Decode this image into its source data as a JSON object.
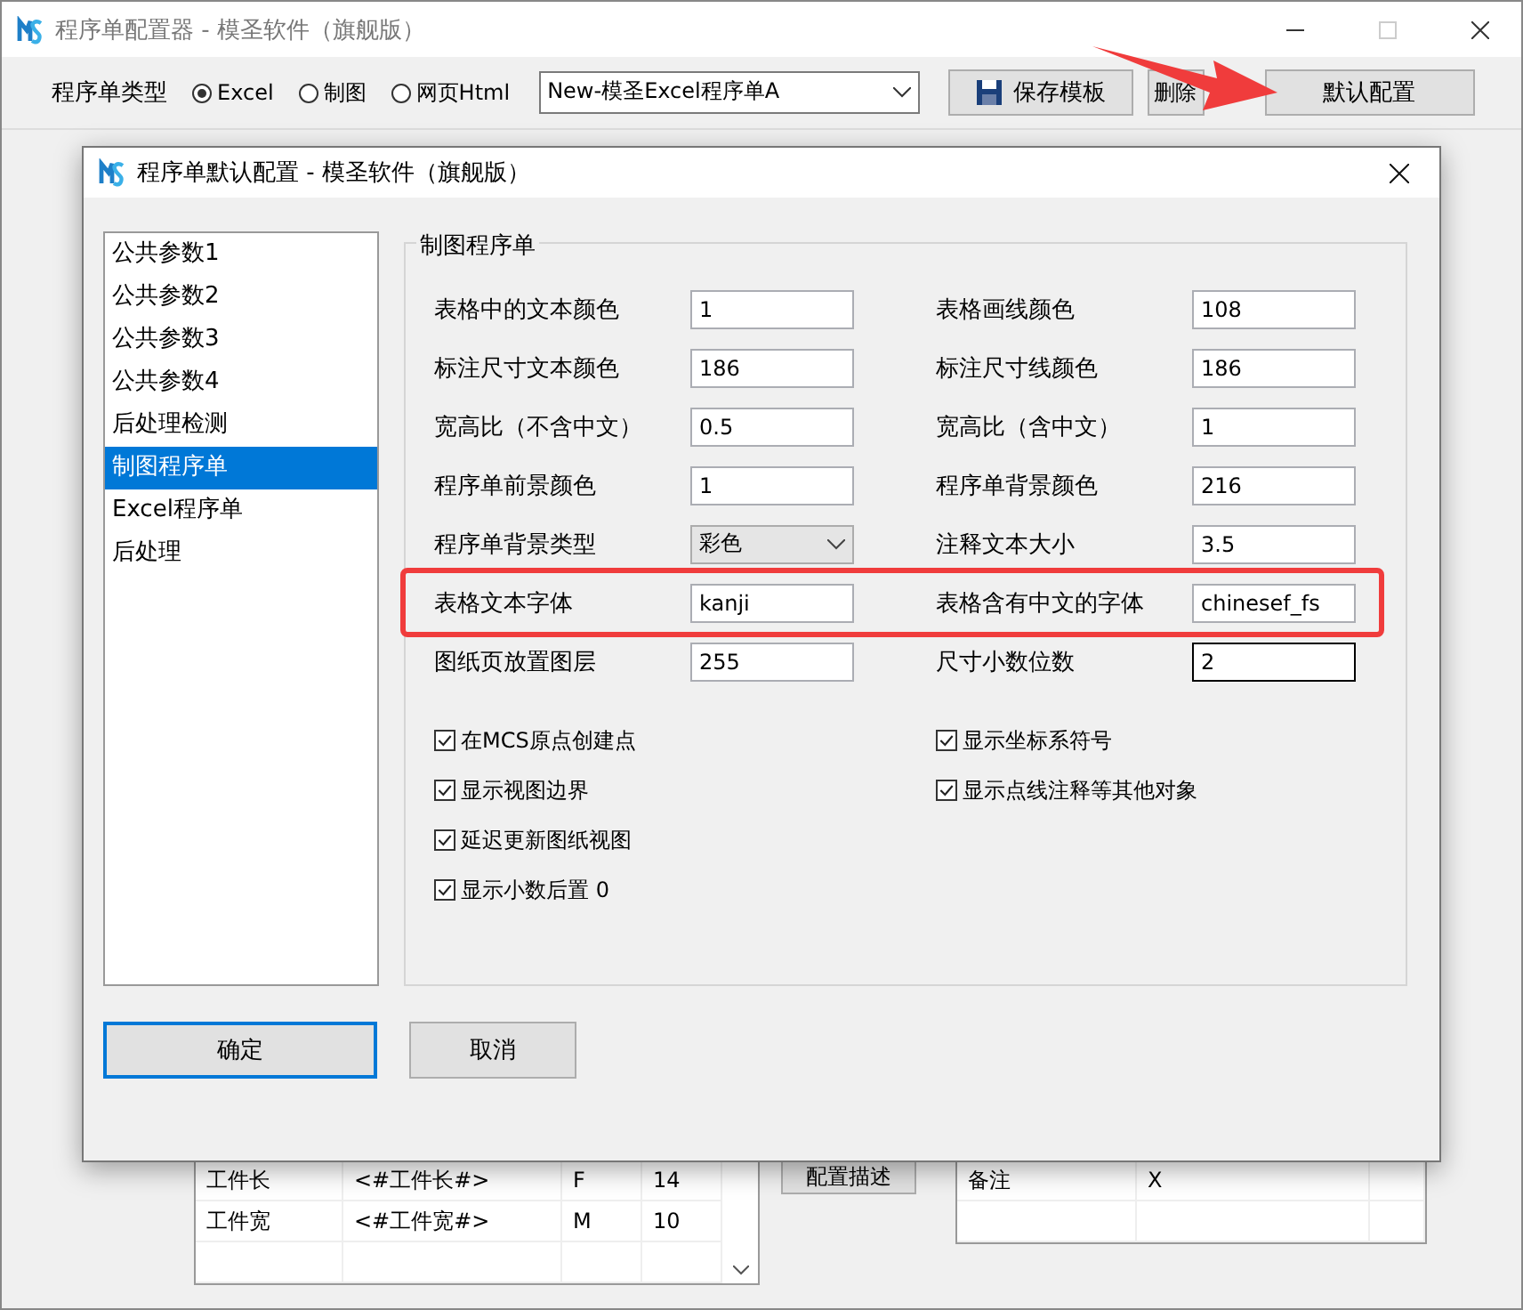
{
  "window": {
    "title": "程序单配置器 - 模圣软件（旗舰版）"
  },
  "toolbar": {
    "type_label": "程序单类型",
    "radios": [
      {
        "label": "Excel",
        "selected": true
      },
      {
        "label": "制图",
        "selected": false
      },
      {
        "label": "网页Html",
        "selected": false
      }
    ],
    "template_combo": {
      "value": "New-模圣Excel程序单A"
    },
    "buttons": [
      {
        "label": "保存模板",
        "kind": "save"
      },
      {
        "label": "删除",
        "kind": "small"
      },
      {
        "label": "默认配置",
        "kind": "wide"
      }
    ]
  },
  "bottom": {
    "left_table": {
      "rows": [
        [
          "工件长",
          "<#工件长#>",
          "F",
          "14"
        ],
        [
          "工件宽",
          "<#工件宽#>",
          "M",
          "10"
        ]
      ]
    },
    "describe_button": "配置描述",
    "right_table": {
      "rows": [
        [
          "备注",
          "X"
        ],
        [
          "",
          ""
        ]
      ]
    }
  },
  "dialog": {
    "title": "程序单默认配置 - 模圣软件（旗舰版）",
    "categories": [
      {
        "label": "公共参数1",
        "selected": false
      },
      {
        "label": "公共参数2",
        "selected": false
      },
      {
        "label": "公共参数3",
        "selected": false
      },
      {
        "label": "公共参数4",
        "selected": false
      },
      {
        "label": "后处理检测",
        "selected": false
      },
      {
        "label": "制图程序单",
        "selected": true
      },
      {
        "label": "Excel程序单",
        "selected": false
      },
      {
        "label": "后处理",
        "selected": false
      }
    ],
    "group": {
      "title": "制图程序单",
      "rows": [
        {
          "highlighted": false,
          "fields": [
            {
              "label": "表格中的文本颜色",
              "value": "1",
              "kind": "text",
              "focused": false
            },
            {
              "label": "表格画线颜色",
              "value": "108",
              "kind": "text",
              "focused": false
            }
          ]
        },
        {
          "highlighted": false,
          "fields": [
            {
              "label": "标注尺寸文本颜色",
              "value": "186",
              "kind": "text",
              "focused": false
            },
            {
              "label": "标注尺寸线颜色",
              "value": "186",
              "kind": "text",
              "focused": false
            }
          ]
        },
        {
          "highlighted": false,
          "fields": [
            {
              "label": "宽高比（不含中文）",
              "value": "0.5",
              "kind": "text",
              "focused": false
            },
            {
              "label": "宽高比（含中文）",
              "value": "1",
              "kind": "text",
              "focused": false
            }
          ]
        },
        {
          "highlighted": false,
          "fields": [
            {
              "label": "程序单前景颜色",
              "value": "1",
              "kind": "text",
              "focused": false
            },
            {
              "label": "程序单背景颜色",
              "value": "216",
              "kind": "text",
              "focused": false
            }
          ]
        },
        {
          "highlighted": false,
          "fields": [
            {
              "label": "程序单背景类型",
              "value": "彩色",
              "kind": "select",
              "focused": false
            },
            {
              "label": "注释文本大小",
              "value": "3.5",
              "kind": "text",
              "focused": false
            }
          ]
        },
        {
          "highlighted": true,
          "fields": [
            {
              "label": "表格文本字体",
              "value": "kanji",
              "kind": "text",
              "focused": false
            },
            {
              "label": "表格含有中文的字体",
              "value": "chinesef_fs",
              "kind": "text",
              "focused": false
            }
          ]
        },
        {
          "highlighted": false,
          "fields": [
            {
              "label": "图纸页放置图层",
              "value": "255",
              "kind": "text",
              "focused": false
            },
            {
              "label": "尺寸小数位数",
              "value": "2",
              "kind": "text",
              "focused": true
            }
          ]
        }
      ],
      "checks_left": [
        {
          "label": "在MCS原点创建点",
          "checked": true
        },
        {
          "label": "显示视图边界",
          "checked": true
        },
        {
          "label": "延迟更新图纸视图",
          "checked": true
        },
        {
          "label": "显示小数后置 0",
          "checked": true
        }
      ],
      "checks_right": [
        {
          "label": "显示坐标系符号",
          "checked": true
        },
        {
          "label": "显示点线注释等其他对象",
          "checked": true
        }
      ]
    },
    "buttons": [
      {
        "label": "确定",
        "default": true
      },
      {
        "label": "取消",
        "default": false
      }
    ]
  }
}
